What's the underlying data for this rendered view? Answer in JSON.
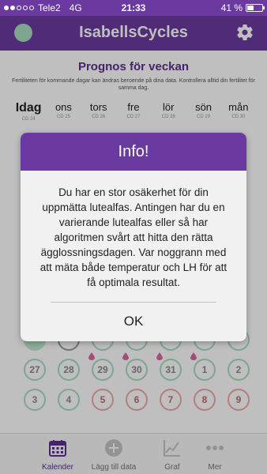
{
  "status": {
    "carrier": "Tele2",
    "network": "4G",
    "time": "21:33",
    "battery": "41 %",
    "battery_level": 0.41
  },
  "header": {
    "title": "IsabellsCycles"
  },
  "forecast": {
    "title": "Prognos för veckan",
    "disclaimer": "Fertiliteten för kommande dagar kan ändras beroende på dina data. Kontrollera alltid din fertilitet för samma dag.",
    "days": [
      {
        "name": "Idag",
        "cd": "CD 24"
      },
      {
        "name": "ons",
        "cd": "CD 25"
      },
      {
        "name": "tors",
        "cd": "CD 26"
      },
      {
        "name": "fre",
        "cd": "CD 27"
      },
      {
        "name": "lör",
        "cd": "CD 28"
      },
      {
        "name": "sön",
        "cd": "CD 29"
      },
      {
        "name": "mån",
        "cd": "CD 30"
      }
    ]
  },
  "calendar": {
    "row1": [
      "27",
      "28",
      "29",
      "30",
      "31",
      "1",
      "2"
    ],
    "row2": [
      "3",
      "4",
      "5",
      "6",
      "7",
      "8",
      "9"
    ]
  },
  "dialog": {
    "title": "Info!",
    "message": "Du har en stor osäkerhet för din uppmätta lutealfas. Antingen har du en varierande lutealfas eller så har algoritmen svårt att hitta den rätta ägglossningsdagen. Var noggrann med att mäta både temperatur och LH för att få optimala resultat.",
    "ok_label": "OK"
  },
  "tabs": [
    {
      "label": "Kalender",
      "icon": "calendar-icon",
      "active": true
    },
    {
      "label": "Lägg till data",
      "icon": "add-icon",
      "active": false
    },
    {
      "label": "Graf",
      "icon": "graph-icon",
      "active": false
    },
    {
      "label": "Mer",
      "icon": "more-icon",
      "active": false
    }
  ],
  "colors": {
    "brand": "#6b3aa0",
    "fertile_low": "#a8dcc0",
    "fertile_high": "#f0a8a8",
    "drop": "#d46aa0"
  }
}
